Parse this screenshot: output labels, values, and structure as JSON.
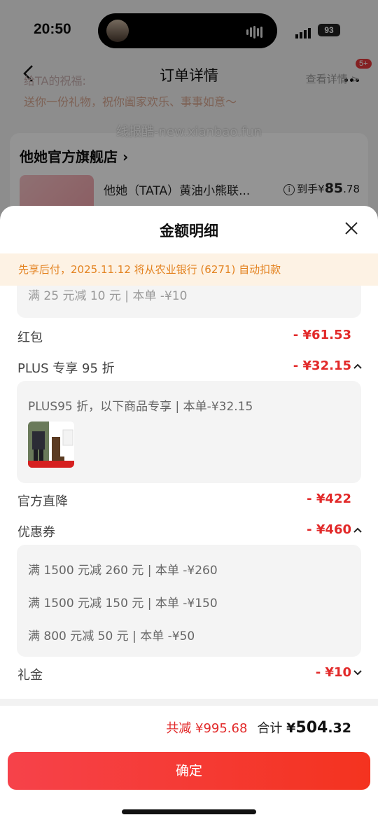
{
  "status_bar": {
    "time": "20:50",
    "battery": "93"
  },
  "nav": {
    "title": "订单详情",
    "badge": "5+"
  },
  "background": {
    "wish_label": "给TA的祝福:",
    "wish_view": "查看详情 >",
    "wish_text": "送你一份礼物，祝你阖家欢乐、事事如意～",
    "watermark": "线报酷-new.xianbao.fun",
    "store_name": "他她官方旗舰店 ›",
    "product_title": "他她（TATA）黄油小熊联...",
    "product_price_label": "到手¥",
    "product_price_int": "85",
    "product_price_dec": ".78"
  },
  "sheet": {
    "title": "金额明细",
    "notice": "先享后付，2025.11.12 将从农业银行 (6271) 自动扣款",
    "partial_line": "满 25 元减 10 元 | 本单 -¥10",
    "rows": {
      "hongbao": {
        "label": "红包",
        "value": "- ¥61.53"
      },
      "plus": {
        "label": "PLUS 专享 95 折",
        "value": "- ¥32.15",
        "detail": "PLUS95 折，以下商品专享 | 本单-¥32.15"
      },
      "official": {
        "label": "官方直降",
        "value": "- ¥422"
      },
      "coupon": {
        "label": "优惠券",
        "value": "- ¥460",
        "details": [
          "满 1500 元减 260 元 | 本单 -¥260",
          "满 1500 元减 150 元 | 本单 -¥150",
          "满 800 元减 50 元 | 本单 -¥50"
        ]
      },
      "lijin": {
        "label": "礼金",
        "value": "- ¥10"
      }
    },
    "summary": {
      "saved": "共减 ¥995.68",
      "total_label": "合计 ",
      "total_currency": "¥",
      "total_int": "504",
      "total_dec": ".32"
    },
    "confirm_label": "确定"
  },
  "colors": {
    "accent_red": "#e22a2a",
    "notice_orange": "#e3821f",
    "button_red": "#f4331f"
  }
}
